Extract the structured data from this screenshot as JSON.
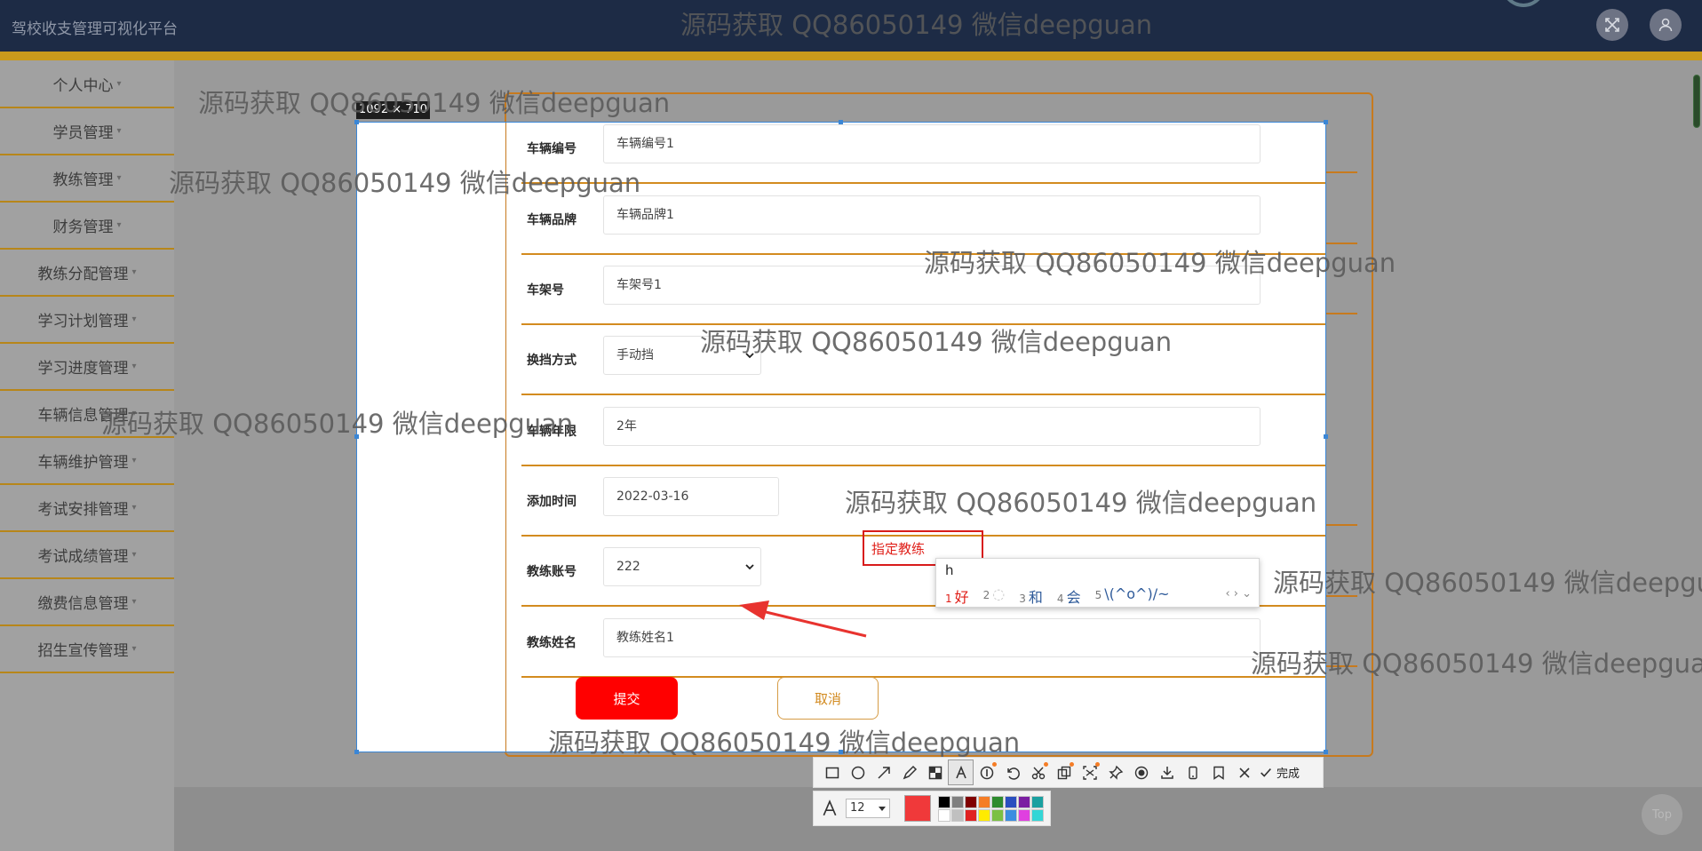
{
  "app": {
    "title": "驾校收支管理可视化平台"
  },
  "header": {
    "fullscreen_icon": "fullscreen-icon",
    "user_icon": "user-icon"
  },
  "sidebar": {
    "items": [
      {
        "label": "个人中心"
      },
      {
        "label": "学员管理"
      },
      {
        "label": "教练管理"
      },
      {
        "label": "财务管理"
      },
      {
        "label": "教练分配管理"
      },
      {
        "label": "学习计划管理"
      },
      {
        "label": "学习进度管理"
      },
      {
        "label": "车辆信息管理"
      },
      {
        "label": "车辆维护管理"
      },
      {
        "label": "考试安排管理"
      },
      {
        "label": "考试成绩管理"
      },
      {
        "label": "缴费信息管理"
      },
      {
        "label": "招生宣传管理"
      }
    ]
  },
  "capture": {
    "size_label": "1092 × 710"
  },
  "form": {
    "rows": [
      {
        "label": "车辆编号",
        "value": "车辆编号1"
      },
      {
        "label": "车辆品牌",
        "value": "车辆品牌1"
      },
      {
        "label": "车架号",
        "value": "车架号1"
      },
      {
        "label": "换挡方式",
        "value": "手动挡"
      },
      {
        "label": "车辆年限",
        "value": "2年"
      },
      {
        "label": "添加时间",
        "value": "2022-03-16"
      },
      {
        "label": "教练账号",
        "value": "222"
      },
      {
        "label": "教练姓名",
        "value": "教练姓名1"
      }
    ],
    "submit_label": "提交",
    "cancel_label": "取消"
  },
  "annotation": {
    "text": "指定教练",
    "color": "#e0201a"
  },
  "ime": {
    "input": "h",
    "candidates": [
      {
        "n": "1",
        "text": "好"
      },
      {
        "n": "2",
        "text": ""
      },
      {
        "n": "3",
        "text": "和"
      },
      {
        "n": "4",
        "text": "会"
      },
      {
        "n": "5",
        "text": "\\(^o^)/~"
      }
    ],
    "nav": "‹ › ⌄"
  },
  "toolbar": {
    "tools": [
      "rectangle-icon",
      "ellipse-icon",
      "arrow-icon",
      "pencil-icon",
      "mosaic-icon",
      "text-icon",
      "number-icon",
      "undo-icon",
      "scissors-icon",
      "copy-icon",
      "crop-icon",
      "pin-icon",
      "record-icon",
      "download-icon",
      "phone-icon",
      "bookmark-icon",
      "close-icon"
    ],
    "done_label": "完成",
    "font_size": "12",
    "current_color": "#f0393a",
    "palette": [
      "#000000",
      "#808080",
      "#800000",
      "#f57d26",
      "#2e8b2e",
      "#2a4fbf",
      "#7b1fa2",
      "#1aa0a0",
      "#ffffff",
      "#c0c0c0",
      "#e02020",
      "#ffeb00",
      "#7bc043",
      "#3b8de0",
      "#e040e0",
      "#33d6d6"
    ]
  },
  "footer": {
    "top_label": "Top"
  },
  "watermark": {
    "text": "源码获取 QQ86050149 微信deepguan"
  }
}
